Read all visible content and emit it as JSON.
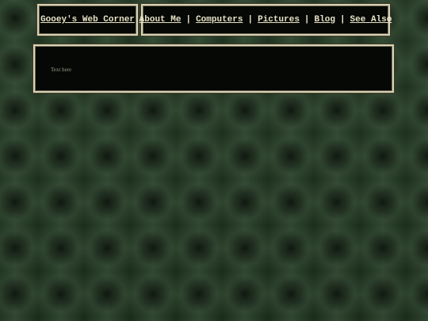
{
  "header": {
    "site_title": "Gooey's Web Corner"
  },
  "nav": {
    "items": [
      {
        "label": "About Me"
      },
      {
        "label": "Computers"
      },
      {
        "label": "Pictures"
      },
      {
        "label": "Blog"
      },
      {
        "label": "See Also"
      }
    ],
    "separator": "|"
  },
  "content": {
    "text": "Text here"
  },
  "colors": {
    "background": "#1c2a1c",
    "box_background": "#050805",
    "box_border": "#d9d2b4",
    "link": "#e8e2c4",
    "body_text": "#9a9a86"
  }
}
